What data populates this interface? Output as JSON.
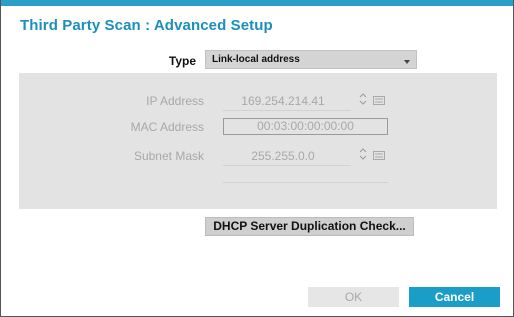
{
  "dialog": {
    "title": "Third Party Scan : Advanced Setup"
  },
  "type_field": {
    "label": "Type",
    "value": "Link-local address"
  },
  "network": {
    "ip_label": "IP Address",
    "ip_value": "169.254.214.41",
    "mac_label": "MAC Address",
    "mac_value": "00:03:00:00:00:00",
    "subnet_label": "Subnet Mask",
    "subnet_value": "255.255.0.0"
  },
  "buttons": {
    "dhcp_check": "DHCP Server Duplication Check...",
    "ok": "OK",
    "cancel": "Cancel"
  },
  "colors": {
    "accent": "#1a9ec8",
    "title": "#1a8fbd",
    "panel": "#e3e3e3",
    "disabled_text": "#a8a8a8"
  }
}
